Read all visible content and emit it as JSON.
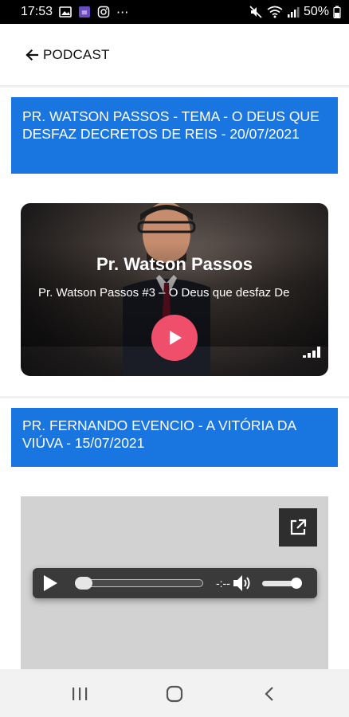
{
  "status_bar": {
    "time": "17:53",
    "notification_icons": [
      "image-icon",
      "teams-icon",
      "instagram-icon",
      "more-dots-icon"
    ],
    "more_label": "···",
    "battery": "50%",
    "system_icons": [
      "mute-icon",
      "wifi-icon",
      "signal-icon",
      "battery-icon"
    ]
  },
  "app_bar": {
    "title": "PODCAST",
    "back_icon": "arrow-left-icon"
  },
  "episodes": [
    {
      "title": "PR. WATSON PASSOS - TEMA - O DEUS QUE DESFAZ DECRETOS DE REIS - 20/07/2021",
      "player": {
        "type": "deezer-embed",
        "heading": "Pr. Watson Passos",
        "subtitle": "Pr. Watson Passos #3 – O Deus que desfaz De",
        "play_icon": "play-icon",
        "logo_icon": "deezer-logo-icon"
      }
    },
    {
      "title": "PR. FERNANDO EVENCIO - A VITÓRIA DA VIÚVA - 15/07/2021",
      "player": {
        "type": "audio",
        "time": "-:--",
        "progress": 0,
        "volume": 1,
        "open_icon": "open-external-icon"
      }
    }
  ],
  "colors": {
    "banner": "#1976e0",
    "play_button": "#ef4f6b",
    "status_bar": "#000000",
    "nav_bar": "#f2f2f2"
  },
  "nav_bar": {
    "buttons": [
      "recents-icon",
      "home-icon",
      "back-icon"
    ]
  }
}
